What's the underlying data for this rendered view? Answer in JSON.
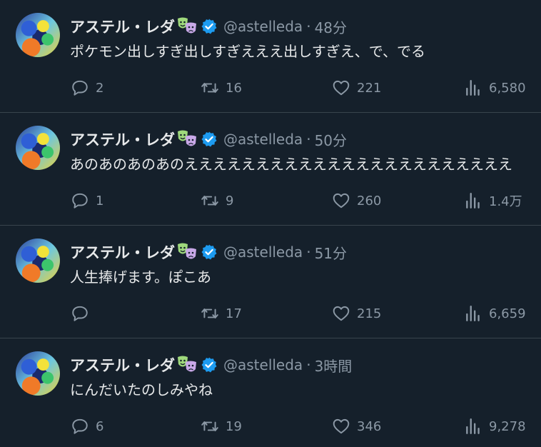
{
  "tweets": [
    {
      "name": "アステル・レダ",
      "handle": "@astelleda",
      "dot": "·",
      "time": "48分",
      "text": "ポケモン出しすぎ出しすぎえええ出しすぎえ、で、でる",
      "replies": "2",
      "retweets": "16",
      "likes": "221",
      "views": "6,580"
    },
    {
      "name": "アステル・レダ",
      "handle": "@astelleda",
      "dot": "·",
      "time": "50分",
      "text": "あのあのあのあのえええええええええええええええええええええええ",
      "replies": "1",
      "retweets": "9",
      "likes": "260",
      "views": "1.4万"
    },
    {
      "name": "アステル・レダ",
      "handle": "@astelleda",
      "dot": "·",
      "time": "51分",
      "text": "人生捧げます。ぽこあ",
      "replies": "",
      "retweets": "17",
      "likes": "215",
      "views": "6,659"
    },
    {
      "name": "アステル・レダ",
      "handle": "@astelleda",
      "dot": "·",
      "time": "3時間",
      "text": "にんだいたのしみやね",
      "replies": "6",
      "retweets": "19",
      "likes": "346",
      "views": "9,278"
    }
  ],
  "icons": {
    "mask": "theater-masks-icon",
    "verified": "verified-badge-icon",
    "reply": "reply-icon",
    "retweet": "retweet-icon",
    "like": "heart-icon",
    "views": "views-bar-chart-icon"
  },
  "colors": {
    "background": "#15202b",
    "text": "#e7e9ea",
    "muted": "#8b98a5",
    "verified": "#1d9bf0",
    "divider": "#38444d"
  }
}
